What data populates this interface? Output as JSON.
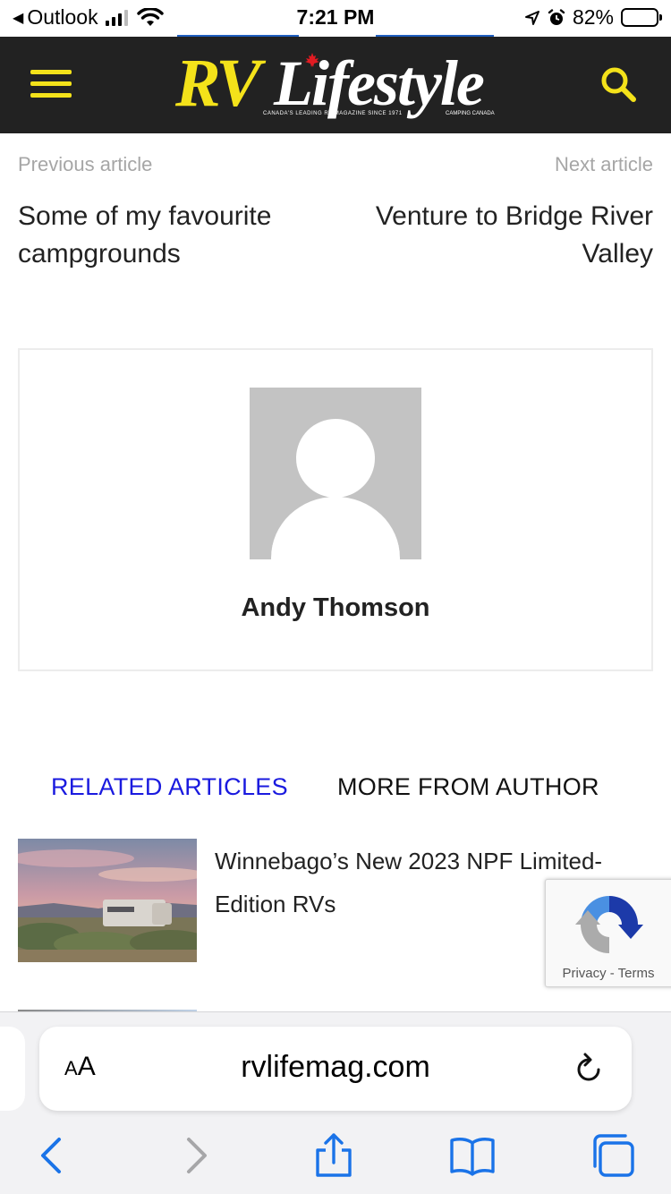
{
  "status_bar": {
    "back_app": "Outlook",
    "time": "7:21 PM",
    "battery": "82%",
    "battery_level": 0.82
  },
  "header": {
    "logo_rv": "RV",
    "logo_lifestyle": "Lifestyle",
    "logo_tagline": "CANADA'S LEADING RV MAGAZINE SINCE 1971",
    "logo_tagline2": "CAMPING CANADA",
    "accent_color": "#f4e21a",
    "background_color": "#222222",
    "menu_icon": "hamburger-menu-icon",
    "search_icon": "search-icon"
  },
  "article_nav": {
    "previous_label": "Previous article",
    "previous_title": "Some of my favourite campgrounds",
    "next_label": "Next article",
    "next_title": "Venture to Bridge River Valley"
  },
  "author": {
    "name": "Andy Thomson",
    "avatar_icon": "default-avatar-icon"
  },
  "tabs": {
    "related": "RELATED ARTICLES",
    "more_from_author": "MORE FROM AUTHOR",
    "active_color": "#1a1adf"
  },
  "related_articles": [
    {
      "title": "Winnebago’s New 2023 NPF Limited-Edition RVs"
    }
  ],
  "recaptcha": {
    "links": "Privacy - Terms"
  },
  "browser": {
    "text_size_label_small": "A",
    "text_size_label_large": "A",
    "url": "rvlifemag.com",
    "toolbar": [
      "back-icon",
      "forward-icon",
      "share-icon",
      "bookmarks-icon",
      "tabs-icon"
    ]
  }
}
